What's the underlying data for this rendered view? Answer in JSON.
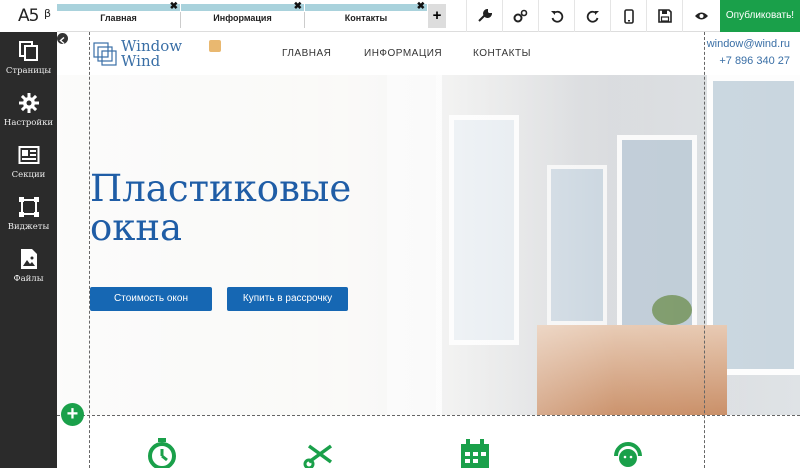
{
  "app": {
    "logo_mark": "A5",
    "logo_beta": "β"
  },
  "sidebar": {
    "items": [
      {
        "label": "Страницы",
        "icon": "pages-icon"
      },
      {
        "label": "Настройки",
        "icon": "gear-icon"
      },
      {
        "label": "Секции",
        "icon": "sections-icon"
      },
      {
        "label": "Виджеты",
        "icon": "widgets-icon"
      },
      {
        "label": "Файлы",
        "icon": "files-icon"
      }
    ]
  },
  "tabs": [
    {
      "label": "Главная",
      "close": "✖"
    },
    {
      "label": "Информация",
      "close": "✖"
    },
    {
      "label": "Контакты",
      "close": "✖"
    }
  ],
  "tab_add": "+",
  "toolbar": {
    "tools": [
      "wrench-icon",
      "settings-gears-icon",
      "undo-icon",
      "redo-icon",
      "mobile-preview-icon",
      "save-icon",
      "preview-eye-icon"
    ],
    "publish_label": "Опубликовать!"
  },
  "site": {
    "brand_line1": "Window",
    "brand_line2": "Wind",
    "nav": [
      "ГЛАВНАЯ",
      "ИНФОРМАЦИЯ",
      "КОНТАКТЫ"
    ],
    "email": "window@wind.ru",
    "phone": "+7 896 340 27",
    "hero_title_line1": "Пластиковые",
    "hero_title_line2": "окна",
    "btn_price": "Стоимость окон",
    "btn_installment": "Купить в рассрочку",
    "add_section": "+",
    "features": [
      "timer-icon",
      "scissors-icon",
      "calendar-icon",
      "support-headset-icon"
    ]
  },
  "colors": {
    "accent_blue": "#1667b3",
    "brand_blue": "#3a6fa6",
    "publish_green": "#1aa04a",
    "sidebar_dark": "#2b2b2b",
    "tab_strip": "#a9d2dc"
  }
}
